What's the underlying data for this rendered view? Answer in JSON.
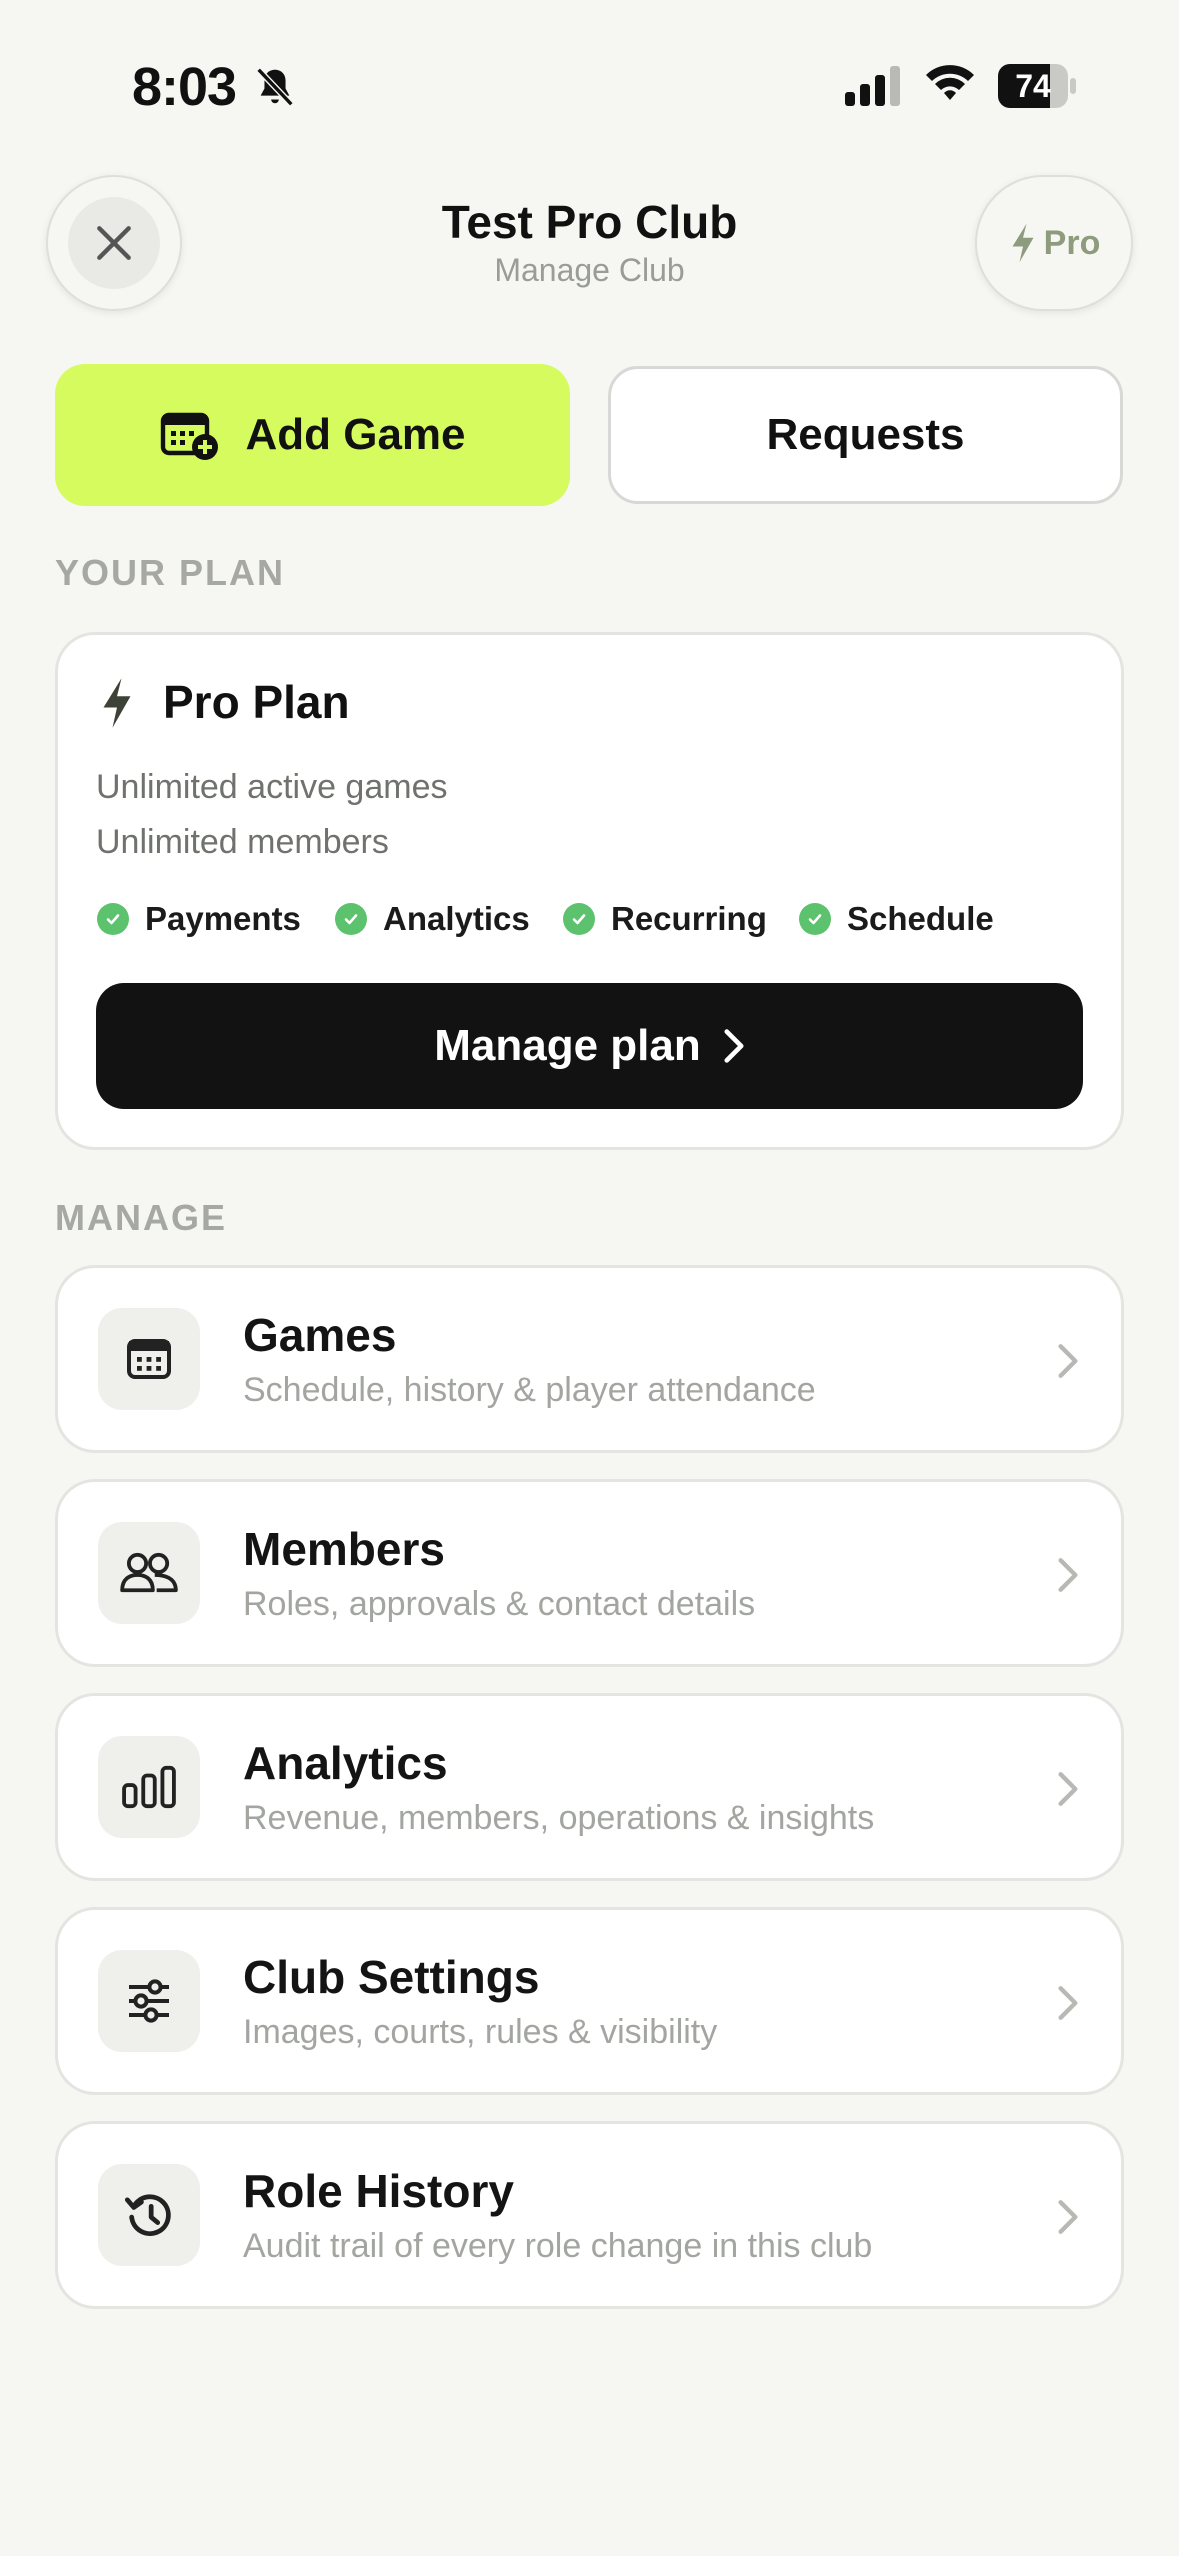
{
  "status_bar": {
    "time": "8:03",
    "battery": "74",
    "icons": [
      "bell-slash-icon",
      "signal-icon",
      "wifi-icon",
      "battery-icon"
    ]
  },
  "header": {
    "title": "Test Pro Club",
    "subtitle": "Manage Club",
    "close_icon": "close-icon",
    "pro_badge_label": "Pro"
  },
  "actions": {
    "add_game_label": "Add Game",
    "requests_label": "Requests"
  },
  "plan_section": {
    "label": "YOUR PLAN",
    "plan_name": "Pro Plan",
    "lines": [
      "Unlimited active games",
      "Unlimited members"
    ],
    "features": [
      "Payments",
      "Analytics",
      "Recurring",
      "Schedule"
    ],
    "manage_button_label": "Manage plan"
  },
  "manage_section": {
    "label": "MANAGE",
    "items": [
      {
        "title": "Games",
        "subtitle": "Schedule, history & player attendance",
        "icon": "calendar-icon"
      },
      {
        "title": "Members",
        "subtitle": "Roles, approvals & contact details",
        "icon": "users-icon"
      },
      {
        "title": "Analytics",
        "subtitle": "Revenue, members, operations & insights",
        "icon": "bar-chart-icon"
      },
      {
        "title": "Club Settings",
        "subtitle": "Images, courts, rules & visibility",
        "icon": "sliders-icon"
      },
      {
        "title": "Role History",
        "subtitle": "Audit trail of every role change in this club",
        "icon": "history-icon"
      }
    ]
  },
  "colors": {
    "accent": "#d6fb5f",
    "background": "#f6f6f3",
    "check_green": "#5cc26e",
    "primary_button": "#121212"
  }
}
